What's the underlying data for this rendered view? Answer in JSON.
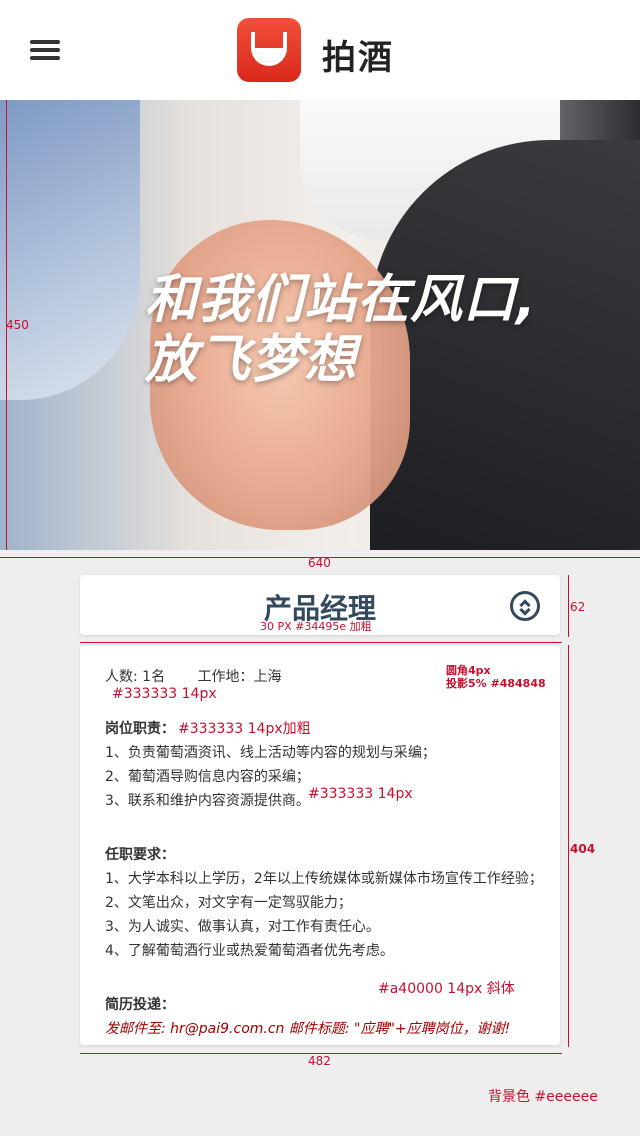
{
  "header": {
    "brand": "拍酒"
  },
  "banner": {
    "line1": "和我们站在风口,",
    "line2": "放飞梦想"
  },
  "job": {
    "title": "产品经理",
    "info_count": "人数: 1名",
    "info_location": "工作地：上海",
    "duties_heading": "岗位职责：",
    "duties": [
      "1、负责葡萄酒资讯、线上活动等内容的规划与采编；",
      "2、葡萄酒导购信息内容的采编；",
      "3、联系和维护内容资源提供商。"
    ],
    "requirements_heading": "任职要求：",
    "requirements": [
      "1、大学本科以上学历，2年以上传统媒体或新媒体市场宣传工作经验；",
      "2、文笔出众，对文字有一定驾驭能力；",
      "3、为人诚实、做事认真，对工作有责任心。",
      "4、了解葡萄酒行业或热爱葡萄酒者优先考虑。"
    ],
    "resume_heading": "简历投递：",
    "resume_line": "发邮件至: hr@pai9.com.cn  邮件标题: \"应聘\"+应聘岗位，谢谢!"
  },
  "annotations": {
    "banner_height": "450",
    "banner_width": "640",
    "title_height": "62",
    "title_width": "482",
    "title_font": "30 PX  #34495e 加粗",
    "card_radius": "圆角4px",
    "card_shadow": "投影5% #484848",
    "info_spec": "#333333 14px",
    "duty_head_spec": "#333333 14px加粗",
    "duty_spec": "#333333 14px",
    "card_height": "404",
    "resume_spec": "#a40000 14px 斜体",
    "card_width": "482",
    "bg_note": "背景色 #eeeeee"
  },
  "colors": {
    "title": "#34495e",
    "text": "#333333",
    "accent": "#a40000",
    "background": "#eeeeee",
    "annotation": "#c8102e"
  }
}
